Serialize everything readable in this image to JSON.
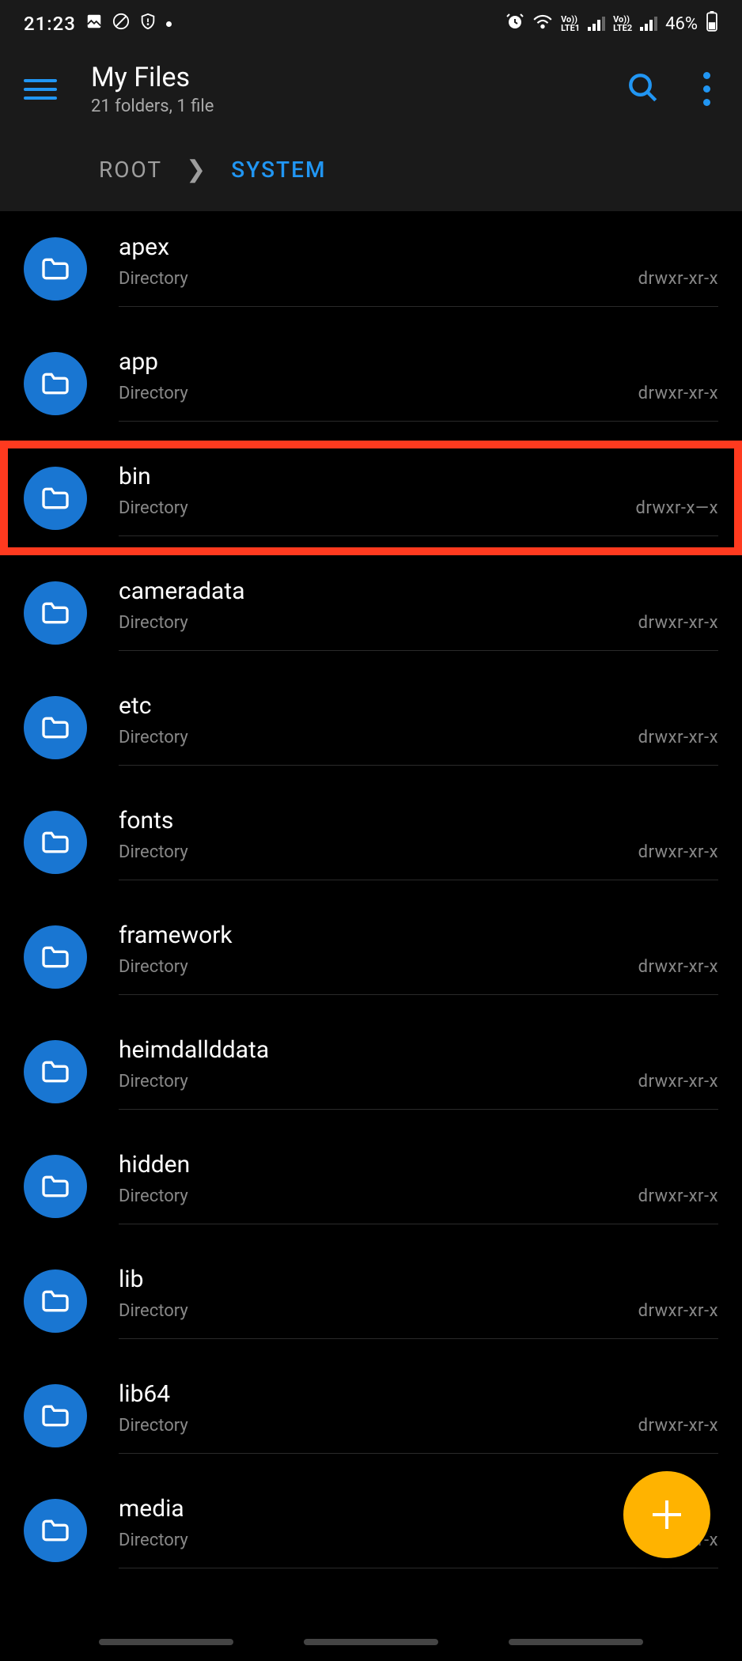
{
  "statusbar": {
    "time": "21:23",
    "battery": "46%"
  },
  "header": {
    "title": "My Files",
    "subtitle": "21 folders, 1 file"
  },
  "breadcrumb": {
    "root": "ROOT",
    "current": "SYSTEM"
  },
  "items": [
    {
      "name": "apex",
      "type": "Directory",
      "perms": "drwxr-xr-x",
      "highlighted": false
    },
    {
      "name": "app",
      "type": "Directory",
      "perms": "drwxr-xr-x",
      "highlighted": false
    },
    {
      "name": "bin",
      "type": "Directory",
      "perms": "drwxr-x—x",
      "highlighted": true
    },
    {
      "name": "cameradata",
      "type": "Directory",
      "perms": "drwxr-xr-x",
      "highlighted": false
    },
    {
      "name": "etc",
      "type": "Directory",
      "perms": "drwxr-xr-x",
      "highlighted": false
    },
    {
      "name": "fonts",
      "type": "Directory",
      "perms": "drwxr-xr-x",
      "highlighted": false
    },
    {
      "name": "framework",
      "type": "Directory",
      "perms": "drwxr-xr-x",
      "highlighted": false
    },
    {
      "name": "heimdallddata",
      "type": "Directory",
      "perms": "drwxr-xr-x",
      "highlighted": false
    },
    {
      "name": "hidden",
      "type": "Directory",
      "perms": "drwxr-xr-x",
      "highlighted": false
    },
    {
      "name": "lib",
      "type": "Directory",
      "perms": "drwxr-xr-x",
      "highlighted": false
    },
    {
      "name": "lib64",
      "type": "Directory",
      "perms": "drwxr-xr-x",
      "highlighted": false
    },
    {
      "name": "media",
      "type": "Directory",
      "perms": "drwxr-xr-x",
      "highlighted": false
    }
  ]
}
